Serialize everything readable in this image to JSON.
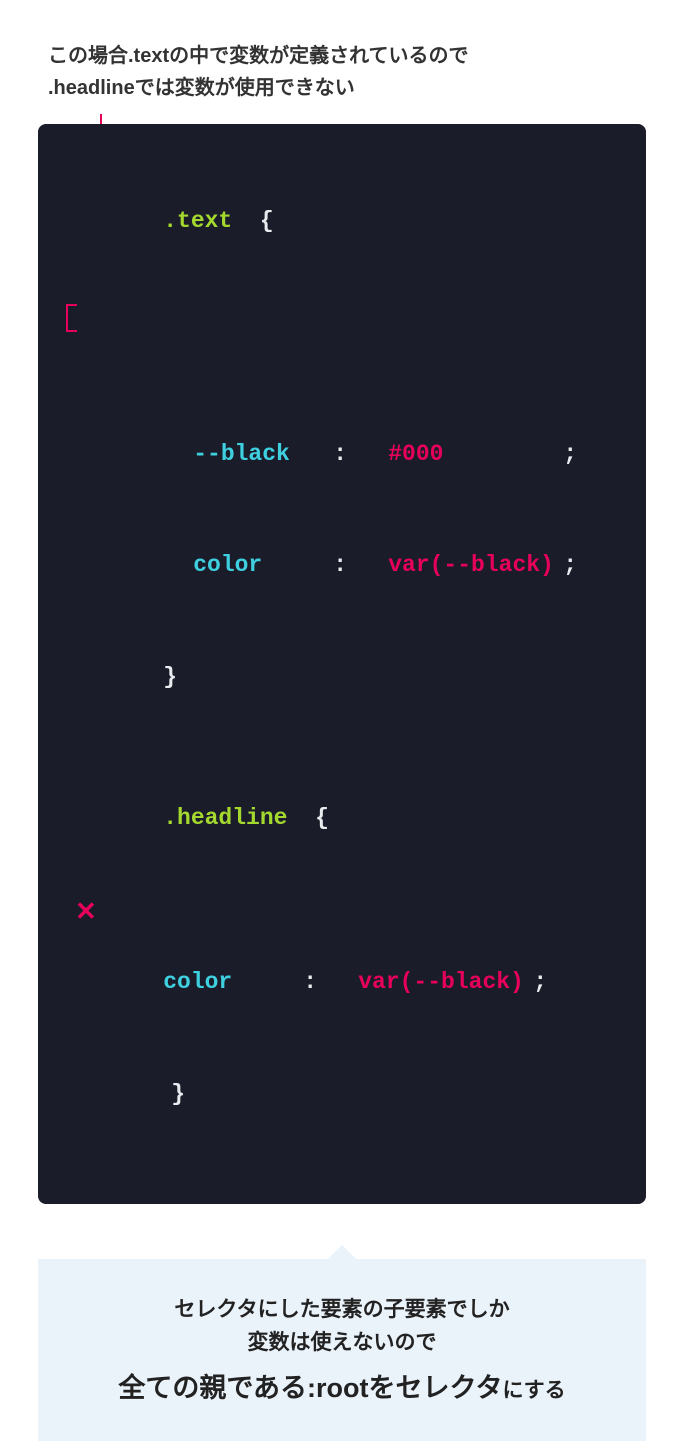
{
  "caption": {
    "line1": "この場合.textの中で変数が定義されているので",
    "line2": ".headlineでは変数が使用できない"
  },
  "code": {
    "rule1": {
      "selector": ".text",
      "brace_open": "{",
      "decl1": {
        "property": "--black",
        "colon": ":",
        "value": "#000",
        "semicolon": ";"
      },
      "decl2": {
        "property": "color",
        "colon": ":",
        "value": "var(--black)",
        "semicolon": ";"
      },
      "brace_close": "}"
    },
    "rule2": {
      "selector": ".headline",
      "brace_open": "{",
      "decl1": {
        "property": "color",
        "colon": ":",
        "value": "var(--black)",
        "semicolon": ";"
      },
      "brace_close": "}"
    },
    "x_mark": "✕"
  },
  "callout": {
    "line1": "セレクタにした要素の子要素でしか",
    "line2": "変数は使えないので",
    "strong": "全ての親である:rootをセレクタ",
    "end": "にする"
  }
}
